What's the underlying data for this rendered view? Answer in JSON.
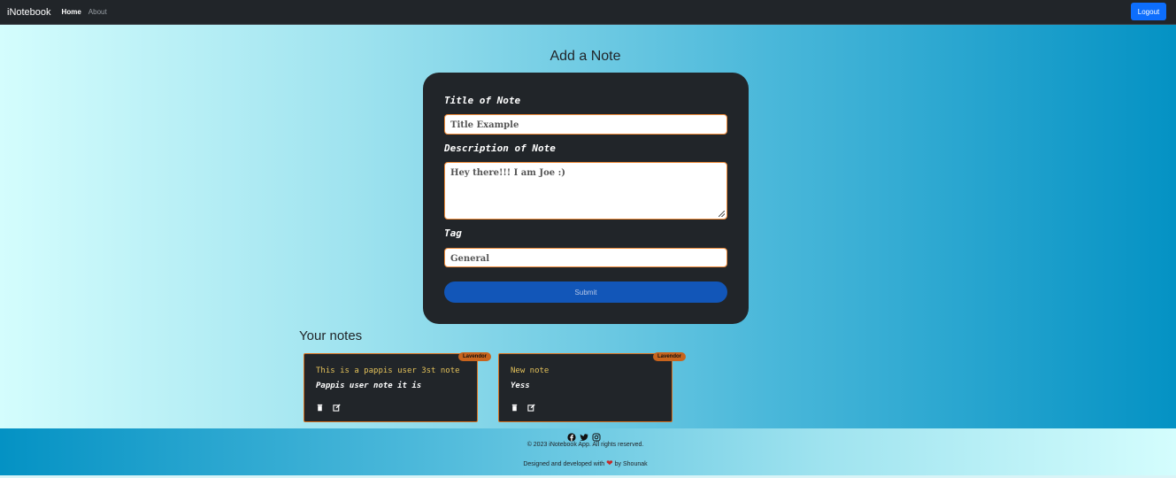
{
  "navbar": {
    "brand": "iNotebook",
    "links": [
      {
        "label": "Home"
      },
      {
        "label": "About"
      }
    ],
    "logout_label": "Logout"
  },
  "add_note": {
    "heading": "Add a Note",
    "title_label": "Title of Note",
    "title_value": "Title Example",
    "description_label": "Description of Note",
    "description_value": "Hey there!!! I am Joe :)",
    "tag_label": "Tag",
    "tag_value": "General",
    "submit_label": "Submit"
  },
  "notes": {
    "heading": "Your notes",
    "items": [
      {
        "tag": "Lavendor",
        "title": "This is a pappis user 3st note",
        "description": "Pappis user note it is"
      },
      {
        "tag": "Lavendor",
        "title": "New note",
        "description": "Yess"
      }
    ]
  },
  "footer": {
    "copyright": "© 2023 iNotebook App. All rights reserved.",
    "credit_prefix": "Designed and developed with",
    "credit_suffix": "by Shounak"
  },
  "colors": {
    "navbar_bg": "#212529",
    "card_bg": "#212529",
    "accent_border": "#f08c3a",
    "submit_bg": "#1256b8",
    "logout_bg": "#0d6efd",
    "note_title": "#e3c15a",
    "badge": "#c8641d"
  },
  "icons": {
    "social": [
      "facebook-icon",
      "twitter-icon",
      "instagram-icon"
    ],
    "note_actions": [
      "trash-icon",
      "edit-icon"
    ],
    "credit": "heart-icon"
  }
}
